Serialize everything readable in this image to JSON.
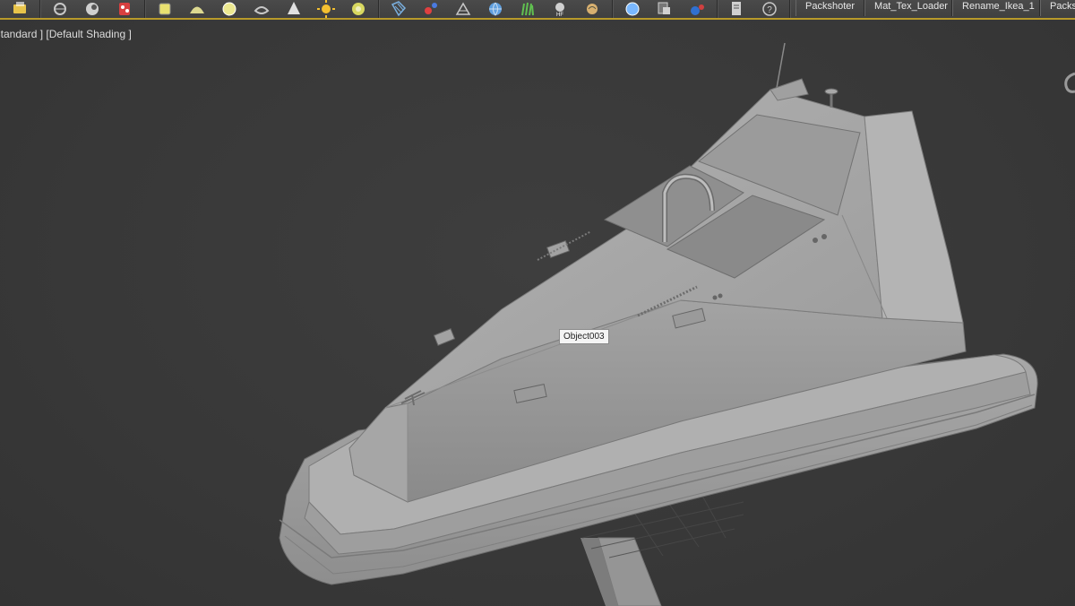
{
  "toolbar": {
    "groups": [
      {
        "buttons": [
          {
            "icon": "layer-icon",
            "color": "#e8c44a"
          }
        ]
      },
      {
        "buttons": [
          {
            "icon": "render-setup-icon",
            "color": "#c8c8c8"
          },
          {
            "icon": "render-frame-icon",
            "color": "#d0d0d0"
          },
          {
            "icon": "material-editor-icon",
            "color": "#d84040"
          }
        ]
      },
      {
        "buttons": [
          {
            "icon": "plane-light-icon",
            "color": "#e8e070"
          },
          {
            "icon": "dome-light-icon",
            "color": "#dcd890"
          },
          {
            "icon": "sphere-light-icon",
            "color": "#ece890"
          },
          {
            "icon": "mesh-light-icon",
            "color": "#c8c8c8"
          },
          {
            "icon": "spot-light-icon",
            "color": "#e0e0e0"
          },
          {
            "icon": "sun-light-icon",
            "color": "#f4c030"
          },
          {
            "icon": "ies-light-icon",
            "color": "#d8d860"
          }
        ]
      },
      {
        "buttons": [
          {
            "icon": "grid-icon",
            "color": "#7ab0e0"
          },
          {
            "icon": "molecule-icon",
            "color": "#e04040"
          },
          {
            "icon": "camera-icon",
            "color": "#c8c8c8"
          },
          {
            "icon": "globe-icon",
            "color": "#60a0e0"
          },
          {
            "icon": "fur-icon",
            "color": "#60c050"
          },
          {
            "icon": "hair-icon",
            "color": "#d0d0d0"
          },
          {
            "icon": "proxy-icon",
            "color": "#d8b070"
          }
        ]
      },
      {
        "buttons": [
          {
            "icon": "sphere-icon",
            "color": "#7ab8ff"
          },
          {
            "icon": "tool-icon",
            "color": "#d0d0d0"
          },
          {
            "icon": "balls-icon",
            "color": "#3070d0"
          }
        ]
      },
      {
        "buttons": [
          {
            "icon": "document-icon",
            "color": "#d0d0d0"
          },
          {
            "icon": "help-icon",
            "color": "#c8c8c8"
          }
        ]
      }
    ],
    "tabs": [
      {
        "label": "Packshoter"
      },
      {
        "label": "Mat_Tex_Loader"
      },
      {
        "label": "Rename_Ikea_1"
      },
      {
        "label": "Packshoter"
      }
    ]
  },
  "viewport": {
    "label_standard": "[ Standard ]",
    "label_shading": "[Default Shading ]",
    "tooltip": "Object003",
    "viewcube_icon": "viewcube-icon",
    "background_color": "#3a3a3a",
    "model_color": "#9a9a9a"
  }
}
